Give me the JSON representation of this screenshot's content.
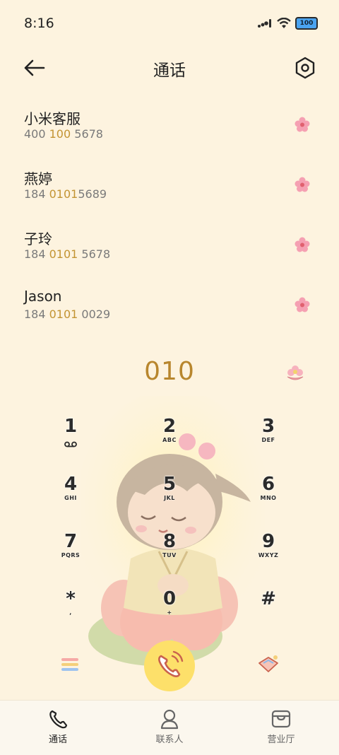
{
  "status": {
    "time": "8:16",
    "battery": "100"
  },
  "header": {
    "title": "通话"
  },
  "calls": [
    {
      "name": "小米客服",
      "num_pre": "400 ",
      "num_hl": "100",
      "num_post": " 5678"
    },
    {
      "name": "燕婷",
      "num_pre": "184 ",
      "num_hl": "0101",
      "num_post": "5689"
    },
    {
      "name": "子玲",
      "num_pre": "184 ",
      "num_hl": "0101",
      "num_post": " 5678"
    },
    {
      "name": "Jason",
      "num_pre": "184 ",
      "num_hl": "0101",
      "num_post": " 0029"
    }
  ],
  "dial": {
    "input": "010"
  },
  "keypad": [
    {
      "digit": "1",
      "letters": ""
    },
    {
      "digit": "2",
      "letters": "ABC"
    },
    {
      "digit": "3",
      "letters": "DEF"
    },
    {
      "digit": "4",
      "letters": "GHI"
    },
    {
      "digit": "5",
      "letters": "JKL"
    },
    {
      "digit": "6",
      "letters": "MNO"
    },
    {
      "digit": "7",
      "letters": "PQRS"
    },
    {
      "digit": "8",
      "letters": "TUV"
    },
    {
      "digit": "9",
      "letters": "WXYZ"
    },
    {
      "digit": "*",
      "letters": ","
    },
    {
      "digit": "0",
      "letters": "+"
    },
    {
      "digit": "#",
      "letters": ""
    }
  ],
  "nav": {
    "calls": "通话",
    "contacts": "联系人",
    "services": "营业厅"
  },
  "colors": {
    "background": "#fdf3df",
    "highlight": "#c39433",
    "call_button": "#fde06a",
    "flower": "#f08aa0"
  }
}
